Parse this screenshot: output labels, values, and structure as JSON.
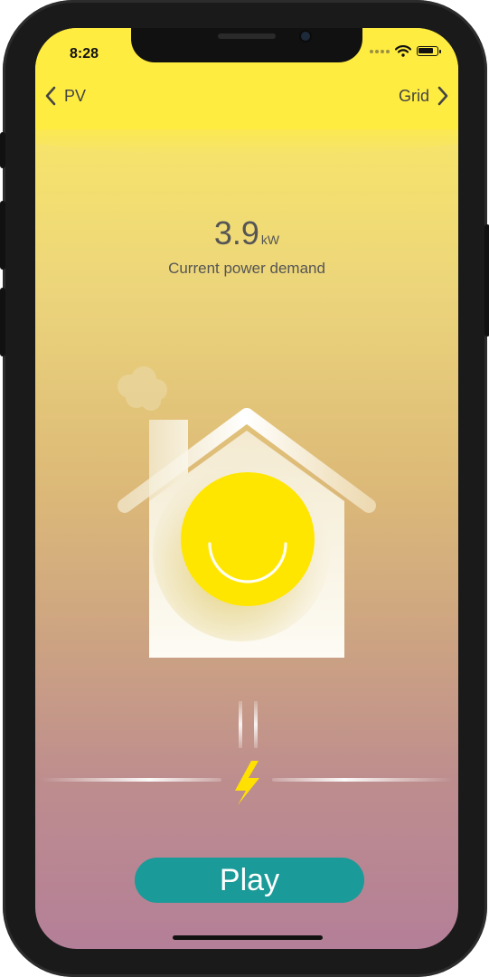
{
  "status_bar": {
    "time": "8:28"
  },
  "nav": {
    "back_label": "PV",
    "forward_label": "Grid"
  },
  "metric": {
    "value": "3.9",
    "unit": "kW",
    "label": "Current power demand"
  },
  "actions": {
    "play_label": "Play"
  },
  "colors": {
    "header_yellow": "#ffec40",
    "sun_yellow": "#ffe600",
    "play_teal": "#1a9a98",
    "bolt_yellow": "#ffe000"
  },
  "icons": {
    "back": "chevron-left-icon",
    "forward": "chevron-right-icon",
    "house": "house-illustration",
    "sun": "smiling-sun-icon",
    "bolt": "lightning-bolt-icon",
    "wifi": "wifi-icon",
    "battery": "battery-icon"
  },
  "battery_level": 0.85
}
